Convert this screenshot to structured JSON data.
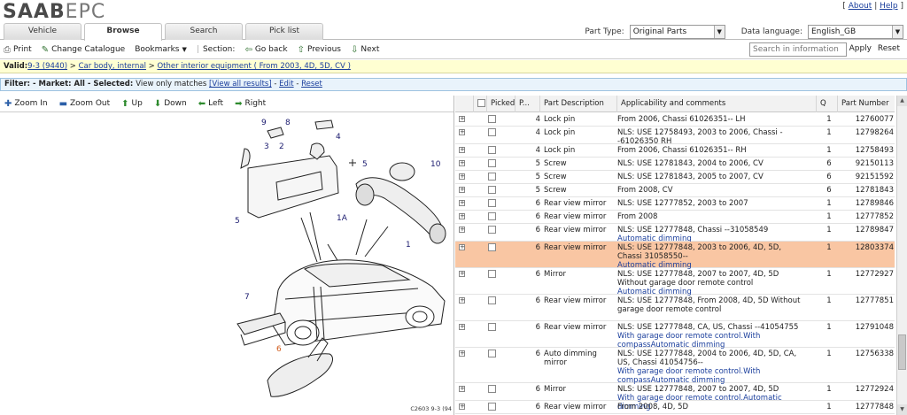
{
  "header": {
    "logo_main": "SAAB",
    "logo_sub": "EPC",
    "links": [
      "About",
      "Help"
    ]
  },
  "tabs": [
    {
      "label": "Vehicle",
      "active": false
    },
    {
      "label": "Browse",
      "active": true
    },
    {
      "label": "Search",
      "active": false
    },
    {
      "label": "Pick list",
      "active": false
    }
  ],
  "filters": {
    "part_type_label": "Part Type:",
    "part_type_value": "Original Parts",
    "language_label": "Data language:",
    "language_value": "English_GB"
  },
  "toolbar": {
    "print": "Print",
    "change_catalogue": "Change Catalogue",
    "bookmarks": "Bookmarks",
    "section": "Section:",
    "go_back": "Go back",
    "previous": "Previous",
    "next": "Next",
    "search_placeholder": "Search in information",
    "apply": "Apply",
    "reset": "Reset"
  },
  "valid": {
    "prefix": "Valid:",
    "model": "9-3 (9440)",
    "sep1": " > ",
    "group": "Car body, internal",
    "sep2": " > ",
    "section": "Other interior equipment ( From 2003, 4D, 5D, CV )"
  },
  "filterbar": {
    "prefix": "Filter: - Market: ",
    "market": "All",
    "selected_prefix": " - Selected: ",
    "selected": "View only matches",
    "view_all": "[View all results]",
    "dash1": " - ",
    "edit": "Edit",
    "dash2": " - ",
    "reset": "Reset"
  },
  "navbar": {
    "zoom_in": "Zoom In",
    "zoom_out": "Zoom Out",
    "up": "Up",
    "down": "Down",
    "left": "Left",
    "right": "Right"
  },
  "diagram": {
    "callouts": [
      "9",
      "8",
      "3",
      "2",
      "4",
      "5",
      "10",
      "5",
      "1A",
      "1",
      "7",
      "6"
    ],
    "reference": "C2603 9-3 (94"
  },
  "table": {
    "headers": [
      "Picked",
      "P...",
      "Part Description",
      "Applicability and comments",
      "Q",
      "Part Number"
    ],
    "rows": [
      {
        "pos": "4",
        "desc": "Lock pin",
        "app": "From 2006, Chassi 61026351-- LH",
        "note": "",
        "q": "1",
        "pn": "12760077",
        "highlight": false
      },
      {
        "pos": "4",
        "desc": "Lock pin",
        "app": "NLS: USE 12758493, 2003 to 2006, Chassi --61026350 RH",
        "note": "",
        "q": "1",
        "pn": "12798264",
        "highlight": false
      },
      {
        "pos": "4",
        "desc": "Lock pin",
        "app": "From 2006, Chassi 61026351-- RH",
        "note": "",
        "q": "1",
        "pn": "12758493",
        "highlight": false
      },
      {
        "pos": "5",
        "desc": "Screw",
        "app": "NLS: USE 12781843, 2004 to 2006, CV",
        "note": "",
        "q": "6",
        "pn": "92150113",
        "highlight": false
      },
      {
        "pos": "5",
        "desc": "Screw",
        "app": "NLS: USE 12781843, 2005 to 2007, CV",
        "note": "",
        "q": "6",
        "pn": "92151592",
        "highlight": false
      },
      {
        "pos": "5",
        "desc": "Screw",
        "app": "From 2008, CV",
        "note": "",
        "q": "6",
        "pn": "12781843",
        "highlight": false
      },
      {
        "pos": "6",
        "desc": "Rear view mirror",
        "app": "NLS: USE 12777852, 2003 to 2007",
        "note": "",
        "q": "1",
        "pn": "12789846",
        "highlight": false
      },
      {
        "pos": "6",
        "desc": "Rear view mirror",
        "app": "From 2008",
        "note": "",
        "q": "1",
        "pn": "12777852",
        "highlight": false
      },
      {
        "pos": "6",
        "desc": "Rear view mirror",
        "app": "NLS: USE 12777848, Chassi --31058549",
        "note": "Automatic dimming",
        "q": "1",
        "pn": "12789847",
        "highlight": false
      },
      {
        "pos": "6",
        "desc": "Rear view mirror",
        "app": "NLS: USE 12777848, 2003 to 2006, 4D, 5D, Chassi 31058550--",
        "note": "Automatic dimming",
        "q": "1",
        "pn": "12803374",
        "highlight": true
      },
      {
        "pos": "6",
        "desc": "Mirror",
        "app": "NLS: USE 12777848, 2007 to 2007, 4D, 5D Without garage door remote control",
        "note": "Automatic dimming",
        "q": "1",
        "pn": "12772927",
        "highlight": false
      },
      {
        "pos": "6",
        "desc": "Rear view mirror",
        "app": "NLS: USE 12777848, From 2008, 4D, 5D Without garage door remote control",
        "note": "",
        "q": "1",
        "pn": "12777851",
        "highlight": false
      },
      {
        "pos": "6",
        "desc": "Rear view mirror",
        "app": "NLS: USE 12777848, CA, US, Chassi --41054755",
        "note": "With garage door remote control.With compassAutomatic dimming",
        "q": "1",
        "pn": "12791048",
        "highlight": false
      },
      {
        "pos": "6",
        "desc": "Auto dimming mirror",
        "app": "NLS: USE 12777848, 2004 to 2006, 4D, 5D, CA, US, Chassi 41054756--",
        "note": "With garage door remote control.With compassAutomatic dimming",
        "q": "1",
        "pn": "12756338",
        "highlight": false
      },
      {
        "pos": "6",
        "desc": "Mirror",
        "app": "NLS: USE 12777848, 2007 to 2007, 4D, 5D",
        "note": "With garage door remote control.Automatic dimming",
        "q": "1",
        "pn": "12772924",
        "highlight": false
      },
      {
        "pos": "6",
        "desc": "Rear view mirror",
        "app": "From 2008, 4D, 5D",
        "note": "",
        "q": "1",
        "pn": "12777848",
        "highlight": false
      }
    ]
  }
}
